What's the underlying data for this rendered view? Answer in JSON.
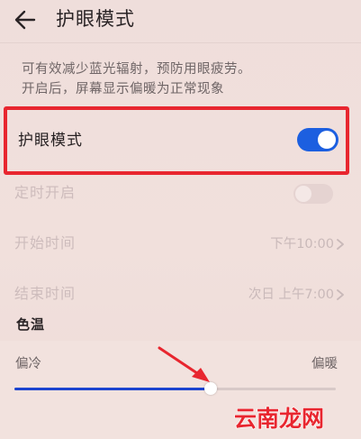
{
  "header": {
    "title": "护眼模式"
  },
  "description": {
    "line1": "可有效减少蓝光辐射，预防用眼疲劳。",
    "line2": "开启后，屏幕显示偏暖为正常现象"
  },
  "eye_comfort": {
    "label": "护眼模式",
    "enabled": true
  },
  "scheduled": {
    "label": "定时开启",
    "enabled": false
  },
  "start_time": {
    "label": "开始时间",
    "value": "下午10:00"
  },
  "end_time": {
    "label": "结束时间",
    "value": "次日 上午7:00"
  },
  "color_temperature": {
    "title": "色温",
    "cool_label": "偏冷",
    "warm_label": "偏暖",
    "value_percent": 61
  },
  "watermark": {
    "text": "云南龙网"
  },
  "colors": {
    "accent": "#1c5fe0",
    "highlight_border": "#e8262f",
    "arrow": "#e8262f",
    "watermark": "#e8262f"
  }
}
